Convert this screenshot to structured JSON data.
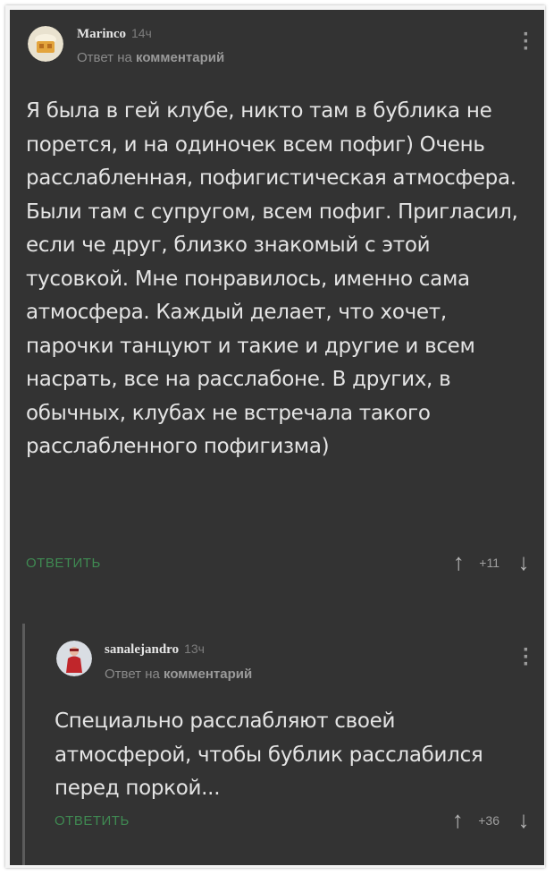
{
  "comments": [
    {
      "username": "Marinco",
      "time": "14ч",
      "reply_prefix": "Ответ на",
      "reply_target": "комментарий",
      "text": "Я была в гей клубе, никто там в бублика не порется, и на одиночек всем пофиг) Очень расслабленная, пофигистическая атмосфера. Были там с супругом, всем пофиг. Пригласил, если че друг, близко знакомый с этой тусовкой. Мне понравилось, именно сама атмосфера. Каждый делает, что хочет, парочки танцуют и такие и другие и всем насрать, все на расслабоне. В других, в обычных, клубах не встречала такого расслабленного пофигизма)",
      "reply_button": "ОТВЕТИТЬ",
      "score": "+11",
      "menu_icon": "vertical-dots-icon",
      "up_icon": "arrow-up-icon",
      "down_icon": "arrow-down-icon"
    },
    {
      "username": "sanalejandro",
      "time": "13ч",
      "reply_prefix": "Ответ на",
      "reply_target": "комментарий",
      "text": "Специально расслабляют своей атмосферой, чтобы бублик расслабился перед поркой...",
      "reply_button": "ОТВЕТИТЬ",
      "score": "+36",
      "menu_icon": "vertical-dots-icon",
      "up_icon": "arrow-up-icon",
      "down_icon": "arrow-down-icon"
    }
  ],
  "colors": {
    "background": "#333333",
    "text": "#e4e4e4",
    "muted": "#8a8a8a",
    "accent_green": "#3f8a52",
    "frame": "#f4f4f4"
  }
}
